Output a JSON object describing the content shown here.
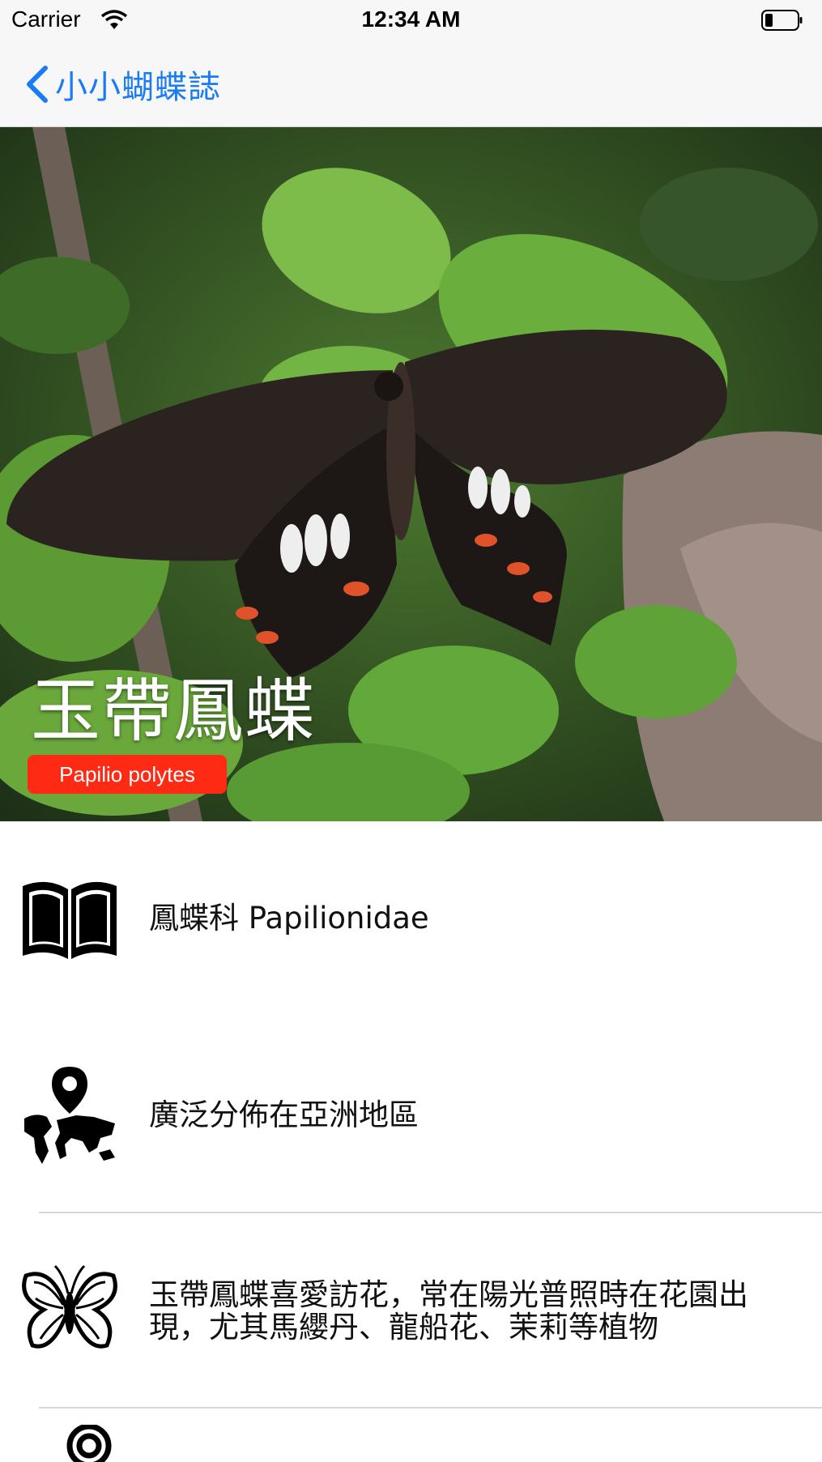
{
  "status_bar": {
    "carrier": "Carrier",
    "time": "12:34 AM"
  },
  "nav": {
    "back_label": "小小蝴蝶誌"
  },
  "hero": {
    "title": "玉帶鳳蝶",
    "scientific_name": "Papilio polytes"
  },
  "rows": [
    {
      "icon": "book-icon",
      "text": "鳳蝶科  Papilionidae"
    },
    {
      "icon": "world-map-pin-icon",
      "text": "廣泛分佈在亞洲地區"
    },
    {
      "icon": "butterfly-icon",
      "text": "玉帶鳳蝶喜愛訪花，常在陽光普照時在花園出現，尤其馬纓丹、龍船花、茉莉等植物"
    },
    {
      "icon": "location-pin-icon",
      "text": ""
    }
  ],
  "colors": {
    "accent": "#1a7cf5",
    "badge": "#ff2a14"
  }
}
